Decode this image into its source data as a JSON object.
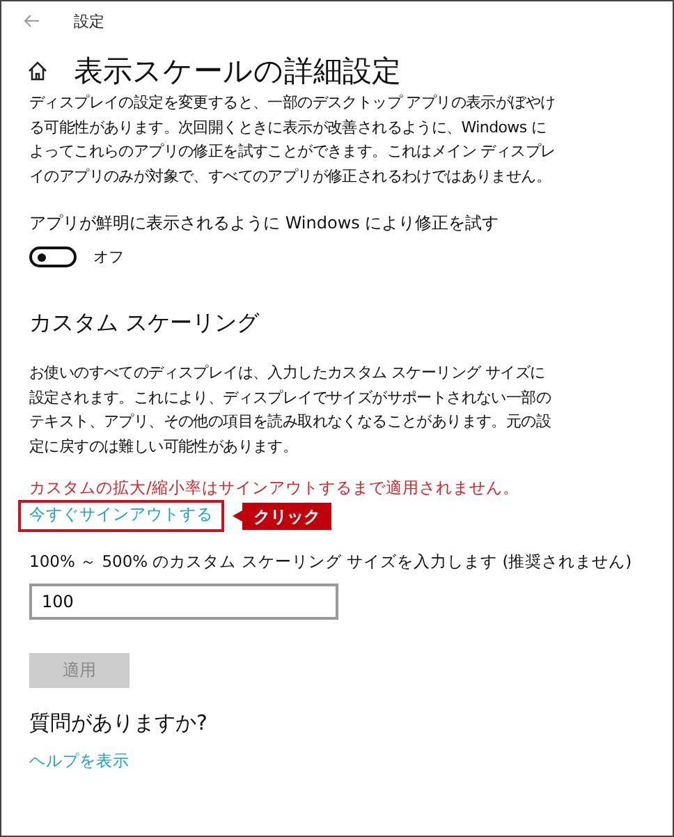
{
  "window": {
    "title": "設定"
  },
  "page_title": "表示スケールの詳細設定",
  "intro": "ディスプレイの設定を変更すると、一部のデスクトップ アプリの表示がぼやける可能性があります。次回開くときに表示が改善されるように、Windows によってこれらのアプリの修正を試すことができます。これはメイン ディスプレイのアプリのみが対象で、すべてのアプリが修正されるわけではありません。",
  "fix_setting": {
    "label": "アプリが鮮明に表示されるように Windows により修正を試す",
    "on": false,
    "state_text": "オフ"
  },
  "custom_scaling": {
    "heading": "カスタム スケーリング",
    "description": "お使いのすべてのディスプレイは、入力したカスタム スケーリング サイズに設定されます。これにより、ディスプレイでサイズがサポートされない一部のテキスト、アプリ、その他の項目を読み取れなくなることがあります。元の設定に戻すのは難しい可能性があります。",
    "warning": "カスタムの拡大/縮小率はサインアウトするまで適用されません。",
    "signout_link": "今すぐサインアウトする",
    "callout": "クリック",
    "input_label": "100% ～ 500% のカスタム スケーリング サイズを入力します (推奨されません)",
    "input_value": "100",
    "apply_button": {
      "label": "適用",
      "disabled": true
    }
  },
  "help": {
    "heading": "質問がありますか?",
    "link": "ヘルプを表示"
  }
}
